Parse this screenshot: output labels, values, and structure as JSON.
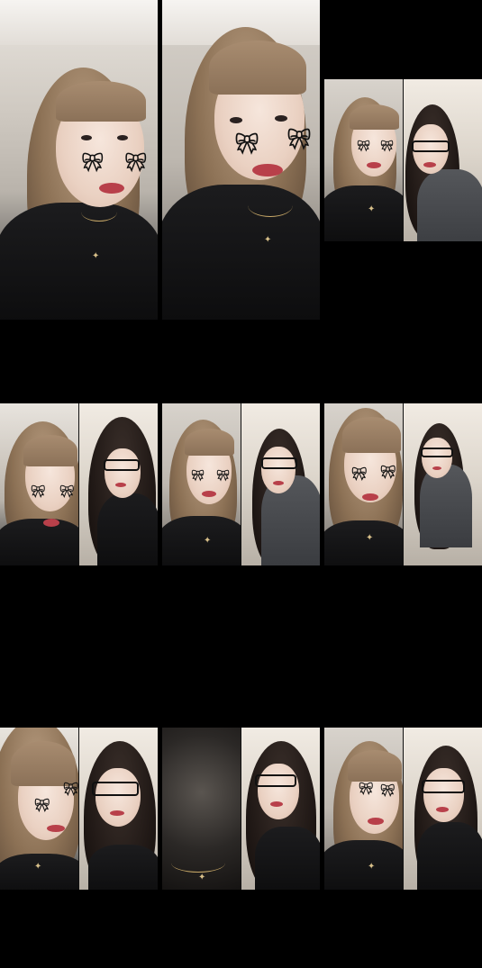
{
  "grid": {
    "tile_1": {
      "people": [
        "woman-bangs-light-hair"
      ]
    },
    "tile_2": {
      "people": [
        "woman-bangs-light-hair"
      ]
    },
    "tile_3": {
      "people": [
        "woman-bangs-light-hair",
        "woman-glasses-dark-hair"
      ]
    },
    "tile_4": {
      "people": [
        "woman-bangs-light-hair",
        "woman-glasses-dark-hair"
      ]
    },
    "tile_5": {
      "people": [
        "woman-bangs-light-hair",
        "woman-glasses-dark-hair"
      ]
    },
    "tile_6": {
      "people": [
        "woman-bangs-light-hair",
        "woman-glasses-dark-hair"
      ]
    },
    "tile_7": {
      "people": [
        "woman-bangs-light-hair",
        "woman-glasses-dark-hair"
      ]
    },
    "tile_8": {
      "people": [
        "blurred-closeup",
        "woman-glasses-dark-hair"
      ]
    },
    "tile_9": {
      "people": [
        "woman-bangs-light-hair",
        "woman-glasses-dark-hair"
      ]
    }
  },
  "colors": {
    "background": "#000000",
    "lips": "#b8404a",
    "jewelry": "#c9a968"
  }
}
